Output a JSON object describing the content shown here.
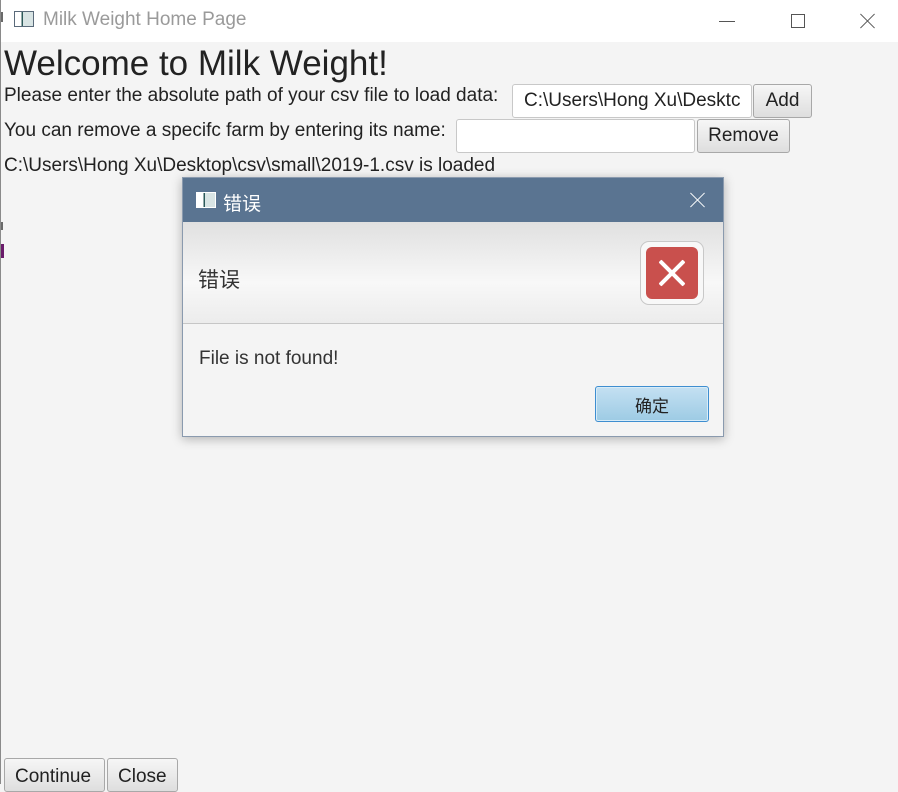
{
  "window": {
    "title": "Milk Weight Home Page"
  },
  "main": {
    "heading": "Welcome to Milk Weight!",
    "load_label": "Please enter the absolute path of your csv file to load data:",
    "load_input_value": "C:\\Users\\Hong Xu\\Desktc",
    "add_button": "Add",
    "remove_label": "You can remove a specifc farm by entering its name:",
    "remove_input_value": "",
    "remove_button": "Remove",
    "status": "C:\\Users\\Hong Xu\\Desktop\\csv\\small\\2019-1.csv is loaded",
    "continue_button": "Continue",
    "close_button": "Close"
  },
  "dialog": {
    "title": "错误",
    "header": "错误",
    "message": "File is not found!",
    "ok_button": "确定"
  },
  "icons": {
    "app": "app-window-icon",
    "minimize": "minimize-icon",
    "maximize": "maximize-icon",
    "close": "close-icon",
    "error": "error-x-icon"
  },
  "colors": {
    "dialog_titlebar": "#5a7491",
    "error_badge": "#c9504d",
    "ok_button_border": "#3e8ed0"
  }
}
